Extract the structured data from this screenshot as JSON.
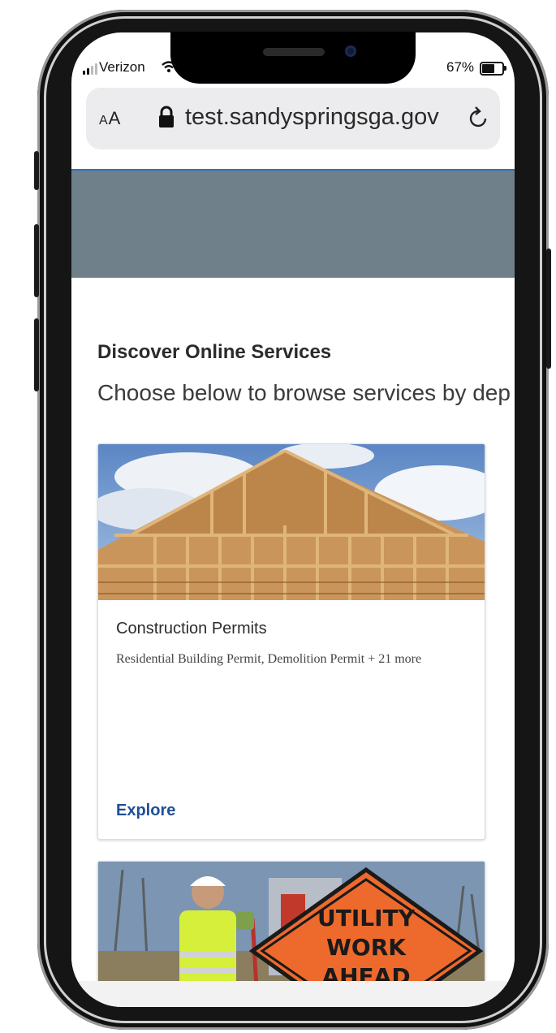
{
  "status_bar": {
    "carrier": "Verizon",
    "battery_percent": "67%",
    "battery_level": 0.67,
    "signal_bars_filled": 2
  },
  "browser": {
    "text_size_label_small": "A",
    "text_size_label_large": "A",
    "url": "test.sandyspringsga.gov",
    "icons": [
      "lock-icon",
      "reload-icon"
    ]
  },
  "page": {
    "section_title": "Discover Online Services",
    "section_subtitle": "Choose below to browse services by dep",
    "cards": [
      {
        "title": "Construction Permits",
        "description": "Residential Building Permit, Demolition Permit + 21 more",
        "link_label": "Explore",
        "image": "house-framing-photo"
      },
      {
        "sign_lines": [
          "UTILITY",
          "WORK",
          "AHEAD"
        ],
        "image": "utility-worker-photo"
      }
    ]
  },
  "colors": {
    "hero_band": "#6f808a",
    "link": "#1f4f96",
    "accent_line": "#2a73c7",
    "sign_orange": "#f0642a"
  }
}
